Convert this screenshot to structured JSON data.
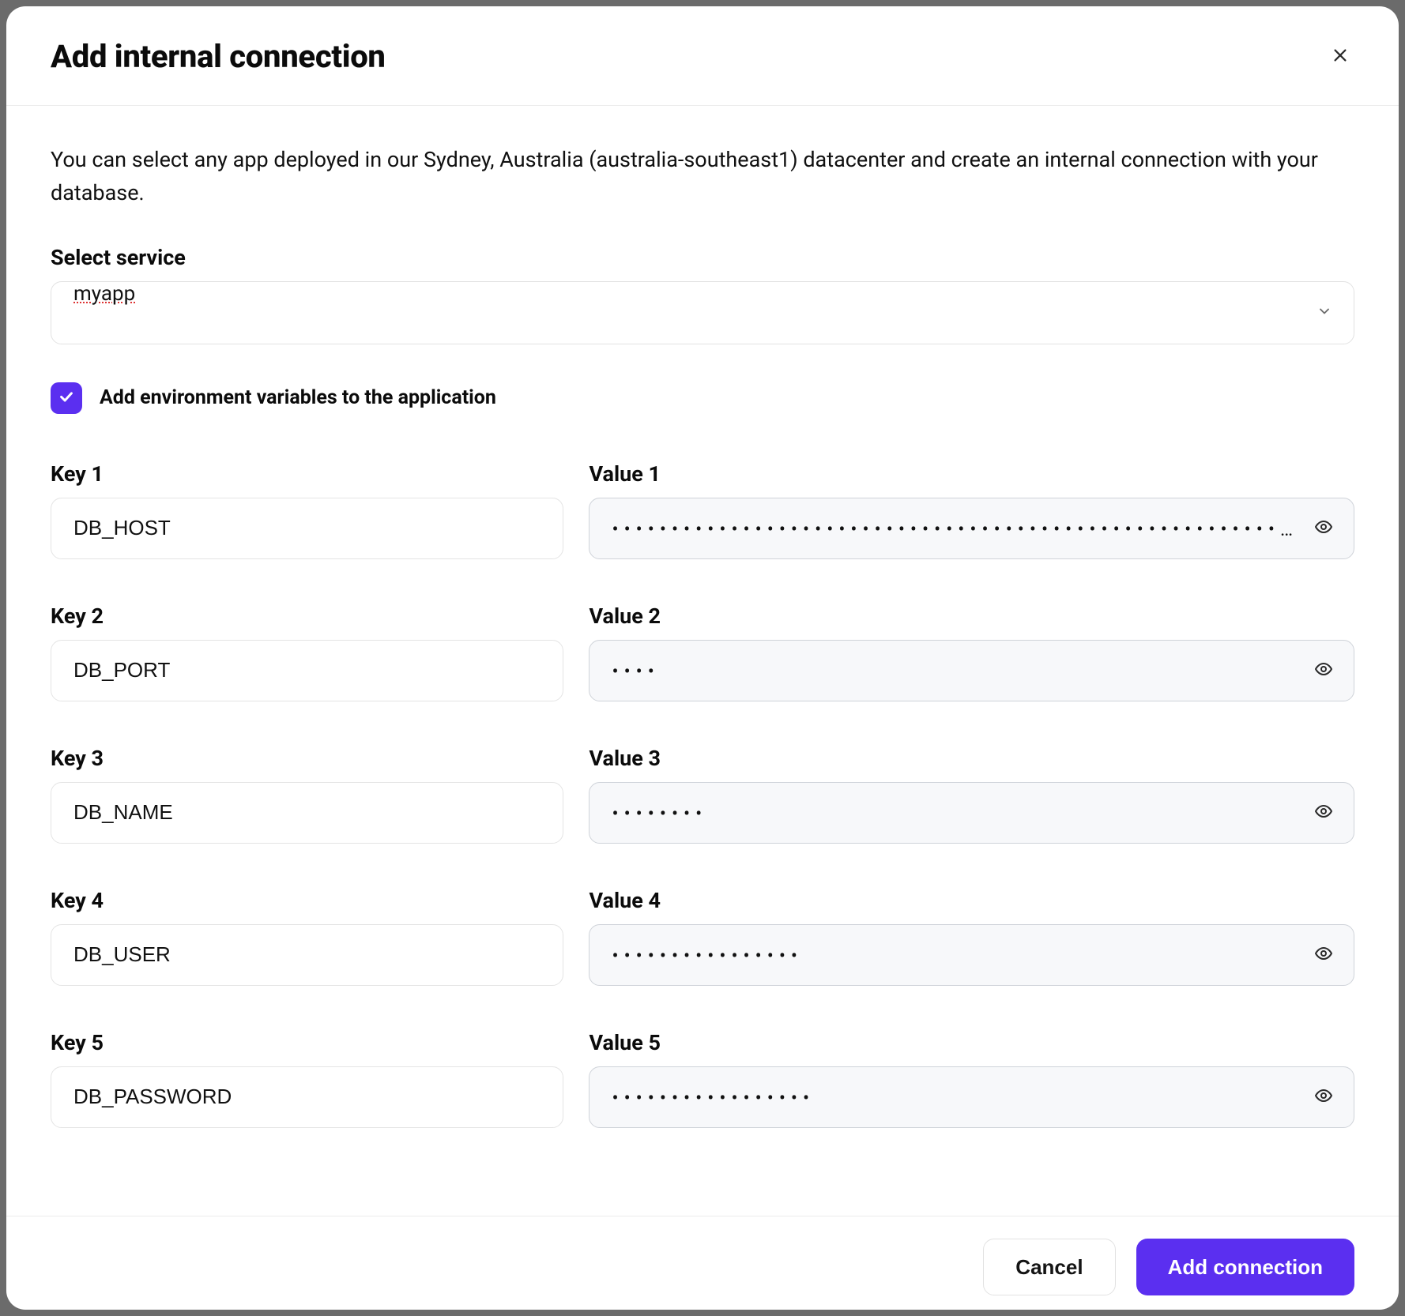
{
  "modal": {
    "title": "Add internal connection",
    "description": "You can select any app deployed in our Sydney, Australia (australia-southeast1) datacenter and create an internal connection with your database.",
    "select_label": "Select service",
    "select_value": "myapp",
    "checkbox_label": "Add environment variables to the application",
    "checkbox_checked": true
  },
  "pairs": [
    {
      "key_label": "Key 1",
      "key": "DB_HOST",
      "value_label": "Value 1",
      "value_masked": "••••••••••••••••••••••••••••••••••••••••••••••••••••••••…"
    },
    {
      "key_label": "Key 2",
      "key": "DB_PORT",
      "value_label": "Value 2",
      "value_masked": "••••"
    },
    {
      "key_label": "Key 3",
      "key": "DB_NAME",
      "value_label": "Value 3",
      "value_masked": "••••••••"
    },
    {
      "key_label": "Key 4",
      "key": "DB_USER",
      "value_label": "Value 4",
      "value_masked": "••••••••••••••••"
    },
    {
      "key_label": "Key 5",
      "key": "DB_PASSWORD",
      "value_label": "Value 5",
      "value_masked": "•••••••••••••••••"
    }
  ],
  "footer": {
    "cancel": "Cancel",
    "submit": "Add connection"
  }
}
